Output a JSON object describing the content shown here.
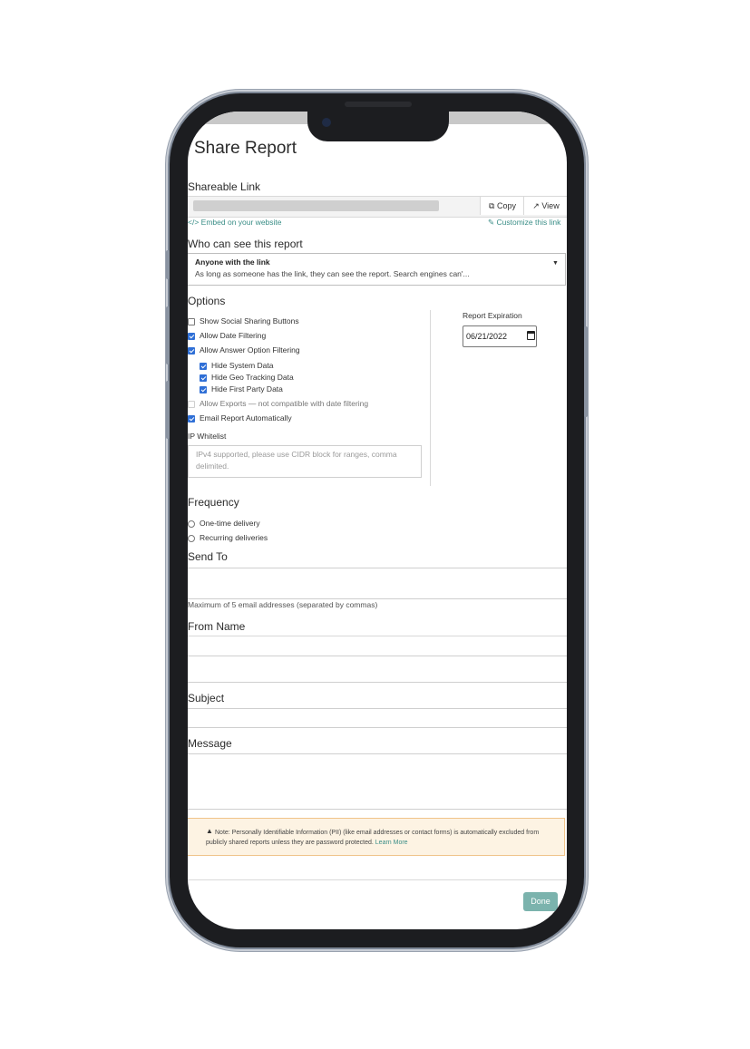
{
  "page": {
    "title": "Share Report"
  },
  "shareable_link": {
    "label": "Shareable Link",
    "copy_label": "Copy",
    "view_label": "View",
    "embed_label": "Embed on your website",
    "customize_label": "Customize this link"
  },
  "visibility": {
    "label": "Who can see this report",
    "selected_title": "Anyone with the link",
    "selected_desc": "As long as someone has the link, they can see the report. Search engines can'..."
  },
  "options": {
    "label": "Options",
    "items": [
      {
        "label": "Show Social Sharing Buttons",
        "checked": false
      },
      {
        "label": "Allow Date Filtering",
        "checked": true
      },
      {
        "label": "Allow Answer Option Filtering",
        "checked": true
      },
      {
        "label": "Hide System Data",
        "checked": true
      },
      {
        "label": "Hide Geo Tracking Data",
        "checked": true
      },
      {
        "label": "Hide First Party Data",
        "checked": true
      },
      {
        "label": "Allow Exports — not compatible with date filtering",
        "checked": false,
        "disabled": true
      },
      {
        "label": "Email Report Automatically",
        "checked": true
      }
    ],
    "ip_whitelist_label": "IP Whitelist",
    "ip_whitelist_placeholder": "IPv4 supported, please use CIDR block for ranges, comma delimited.",
    "expiration_label": "Report Expiration",
    "expiration_value": "06/21/2022"
  },
  "frequency": {
    "label": "Frequency",
    "options": [
      "One-time delivery",
      "Recurring deliveries"
    ]
  },
  "send_to": {
    "label": "Send To",
    "help": "Maximum of 5 email addresses (separated by commas)"
  },
  "from_name": {
    "label": "From Name"
  },
  "subject": {
    "label": "Subject"
  },
  "message": {
    "label": "Message"
  },
  "note": {
    "text": "Note: Personally Identifiable Information (PII) (like email addresses or contact forms) is automatically excluded from publicly shared reports unless they are password protected.",
    "link": "Learn More"
  },
  "footer": {
    "done_label": "Done"
  },
  "colors": {
    "accent": "#3a8e87",
    "checkbox": "#2f6fd6",
    "done_button": "#7bb3ad",
    "note_bg": "#fdf3e3"
  },
  "icons": [
    "copy-icon",
    "external-link-icon",
    "code-icon",
    "wrench-icon",
    "caret-down-icon",
    "calendar-icon",
    "warning-icon"
  ]
}
